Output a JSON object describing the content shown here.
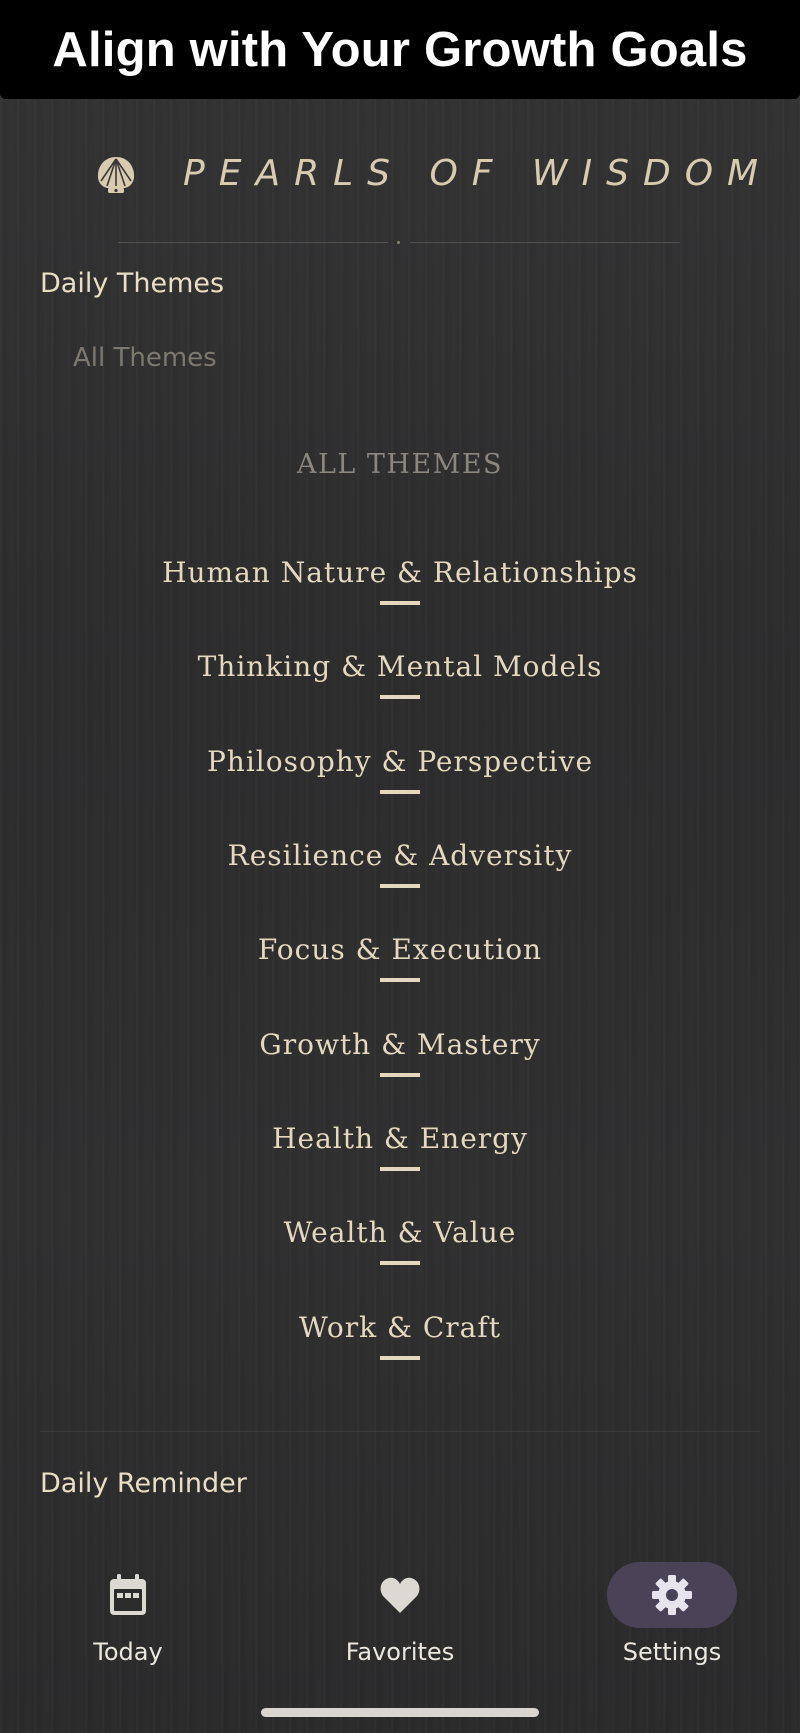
{
  "banner": {
    "title": "Align with Your Growth Goals"
  },
  "brand": {
    "title": "PEARLS OF WISDOM",
    "icon": "pearl-shell-icon"
  },
  "daily_themes": {
    "heading": "Daily Themes",
    "filter_label": "All Themes"
  },
  "themes": {
    "caption": "ALL THEMES",
    "items": [
      {
        "label": "Human Nature & Relationships"
      },
      {
        "label": "Thinking & Mental Models"
      },
      {
        "label": "Philosophy & Perspective"
      },
      {
        "label": "Resilience & Adversity"
      },
      {
        "label": "Focus & Execution"
      },
      {
        "label": "Growth & Mastery"
      },
      {
        "label": "Health & Energy"
      },
      {
        "label": "Wealth & Value"
      },
      {
        "label": "Work & Craft"
      }
    ]
  },
  "daily_reminder": {
    "heading": "Daily Reminder"
  },
  "bottom_nav": {
    "items": [
      {
        "label": "Today",
        "icon": "calendar-icon",
        "active": false
      },
      {
        "label": "Favorites",
        "icon": "heart-icon",
        "active": false
      },
      {
        "label": "Settings",
        "icon": "gear-icon",
        "active": true
      }
    ]
  },
  "colors": {
    "accent_text": "#e4d9bf",
    "active_nav_pill": "#4a4358",
    "background": "#2b2b2c"
  }
}
